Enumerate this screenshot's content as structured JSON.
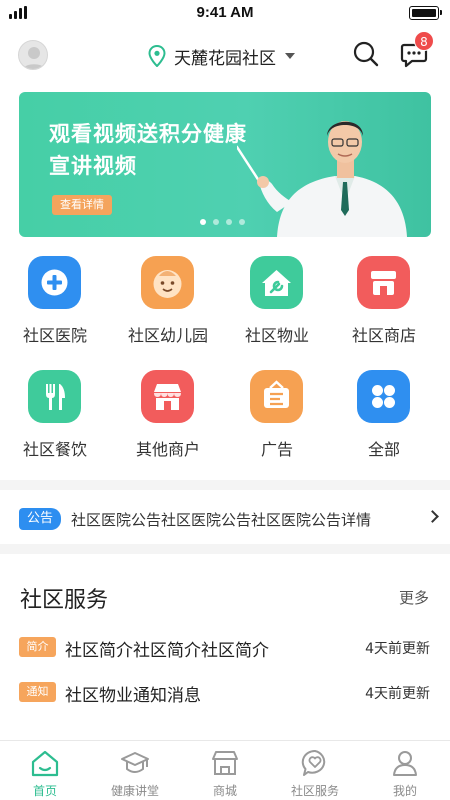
{
  "status_bar": {
    "time": "9:41 AM"
  },
  "header": {
    "community": "天麓花园社区",
    "message_count": "8"
  },
  "banner": {
    "line1": "观看视频送积分健康",
    "line2": "宣讲视频",
    "button": "查看详情",
    "slide_count": 4,
    "active_slide": 1
  },
  "services": [
    {
      "label": "社区医院",
      "icon": "hospital-plus-icon",
      "color": "#2f8ff0"
    },
    {
      "label": "社区幼儿园",
      "icon": "baby-face-icon",
      "color": "#f6a152"
    },
    {
      "label": "社区物业",
      "icon": "house-wrench-icon",
      "color": "#3fcb9b"
    },
    {
      "label": "社区商店",
      "icon": "shop-icon",
      "color": "#f25c5c"
    },
    {
      "label": "社区餐饮",
      "icon": "fork-knife-icon",
      "color": "#3fcb9b"
    },
    {
      "label": "其他商户",
      "icon": "storefront-icon",
      "color": "#f25c5c"
    },
    {
      "label": "广告",
      "icon": "ad-board-icon",
      "color": "#f6a152"
    },
    {
      "label": "全部",
      "icon": "four-squares-icon",
      "color": "#2f8ff0"
    }
  ],
  "notice": {
    "tag": "公告",
    "text": "社区医院公告社区医院公告社区医院公告详情"
  },
  "community_service": {
    "title": "社区服务",
    "more": "更多",
    "items": [
      {
        "tag": "简介",
        "text": "社区简介社区简介社区简介",
        "time": "4天前更新"
      },
      {
        "tag": "通知",
        "text": "社区物业通知消息",
        "time": "4天前更新"
      }
    ]
  },
  "tabbar": {
    "items": [
      {
        "label": "首页",
        "icon": "home-icon",
        "active": true
      },
      {
        "label": "健康讲堂",
        "icon": "graduation-cap-icon",
        "active": false
      },
      {
        "label": "商城",
        "icon": "mall-icon",
        "active": false
      },
      {
        "label": "社区服务",
        "icon": "heart-chat-icon",
        "active": false
      },
      {
        "label": "我的",
        "icon": "person-icon",
        "active": false
      }
    ]
  },
  "colors": {
    "accent": "#2dbd90",
    "badge": "#ef4b4b",
    "notice_tag": "#2d8ef0",
    "orange_tag": "#f6a55c"
  }
}
